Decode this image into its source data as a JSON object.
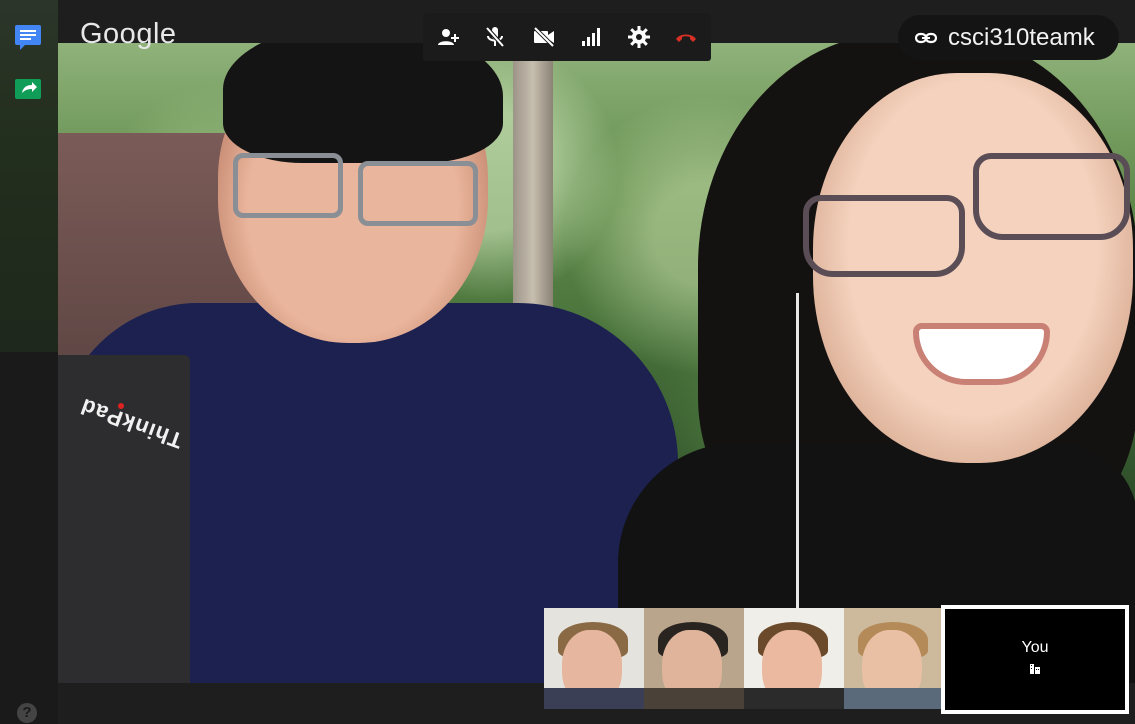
{
  "app": {
    "logo_text": "Google"
  },
  "meeting": {
    "link_label": "csci310teamk"
  },
  "toolbar": {
    "buttons": [
      {
        "name": "add-person",
        "icon": "person-add-icon",
        "color": "#ffffff"
      },
      {
        "name": "microphone",
        "icon": "mic-off-icon",
        "color": "#ffffff"
      },
      {
        "name": "camera",
        "icon": "videocam-off-icon",
        "color": "#ffffff"
      },
      {
        "name": "bandwidth",
        "icon": "signal-bars-icon",
        "color": "#ffffff"
      },
      {
        "name": "settings",
        "icon": "gear-icon",
        "color": "#ffffff"
      },
      {
        "name": "hang-up",
        "icon": "hangup-icon",
        "color": "#d93025"
      }
    ]
  },
  "sidebar": {
    "buttons": [
      {
        "name": "chat",
        "icon": "chat-icon",
        "color": "#4285f4"
      },
      {
        "name": "screen-share",
        "icon": "share-screen-icon",
        "color": "#0f9d58"
      }
    ],
    "help_label": "?"
  },
  "laptop": {
    "brand_text": "ThinkPad"
  },
  "filmstrip": {
    "participants": [
      {
        "label": ""
      },
      {
        "label": ""
      },
      {
        "label": ""
      },
      {
        "label": ""
      }
    ],
    "self": {
      "label": "You"
    }
  }
}
